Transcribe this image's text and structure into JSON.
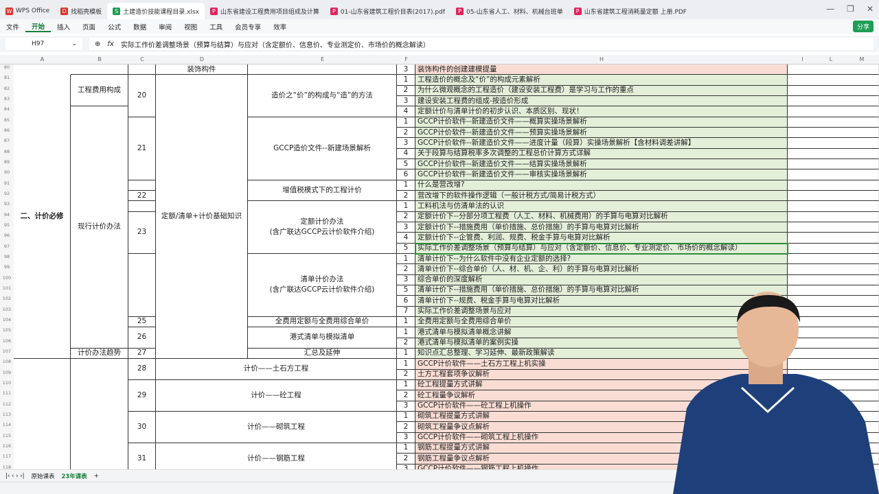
{
  "tabs": [
    {
      "label": "WPS Office",
      "color": "#d9342b",
      "glyph": "W"
    },
    {
      "label": "找稻壳模板",
      "color": "#d9342b",
      "glyph": "D"
    },
    {
      "label": "土建造价技能课程目录.xlsx",
      "color": "#1f9d55",
      "glyph": "S",
      "active": true
    },
    {
      "label": "山东省建设工程费用项目组成及计算",
      "color": "#e0245e",
      "glyph": "P"
    },
    {
      "label": "01-山东省建筑工程价目表(2017).pdf",
      "color": "#e0245e",
      "glyph": "P"
    },
    {
      "label": "05-山东省人工、材料、机械台班单",
      "color": "#e0245e",
      "glyph": "P"
    },
    {
      "label": "山东省建筑工程消耗量定额 上册.PDF",
      "color": "#e0245e",
      "glyph": "P"
    }
  ],
  "menu": [
    "文件",
    "开始",
    "插入",
    "页面",
    "公式",
    "数据",
    "审阅",
    "视图",
    "工具",
    "会员专享",
    "效率"
  ],
  "share_label": "分享",
  "name_box": "H97",
  "formula": "实际工作价差调整场景（预算与结算）与应对（含定额价、信息价、专业测定价、市场价的概念解读）",
  "columns": [
    "A",
    "B",
    "C",
    "D",
    "E",
    "F",
    "H",
    "I",
    "L",
    "M"
  ],
  "colors": {
    "green": "#e3efd9",
    "pink": "#f9ddd4",
    "select": "#2e8b3a"
  },
  "merged": [
    {
      "col": "A",
      "from": 81,
      "to": 107,
      "text": "二、计价必修",
      "bold": true
    },
    {
      "col": "A",
      "from": 108,
      "to": 118,
      "text": ""
    },
    {
      "col": "B",
      "from": 80,
      "to": 80,
      "text": ""
    },
    {
      "col": "B",
      "from": 81,
      "to": 83,
      "text": "工程费用构成"
    },
    {
      "col": "B",
      "from": 84,
      "to": 106,
      "text": "现行计价办法"
    },
    {
      "col": "B",
      "from": 107,
      "to": 107,
      "text": "计价办法趋势"
    },
    {
      "col": "B",
      "from": 108,
      "to": 118,
      "text": ""
    },
    {
      "col": "C",
      "from": 80,
      "to": 80,
      "text": ""
    },
    {
      "col": "C",
      "from": 81,
      "to": 84,
      "text": "20"
    },
    {
      "col": "C",
      "from": 85,
      "to": 90,
      "text": "21"
    },
    {
      "col": "C",
      "from": 91,
      "to": 91,
      "text": ""
    },
    {
      "col": "C",
      "from": 92,
      "to": 92,
      "text": "22"
    },
    {
      "col": "C",
      "from": 93,
      "to": 93,
      "text": ""
    },
    {
      "col": "C",
      "from": 94,
      "to": 97,
      "text": "23"
    },
    {
      "col": "C",
      "from": 98,
      "to": 103,
      "text": ""
    },
    {
      "col": "C",
      "from": 104,
      "to": 104,
      "text": "25"
    },
    {
      "col": "C",
      "from": 105,
      "to": 106,
      "text": "26"
    },
    {
      "col": "C",
      "from": 107,
      "to": 107,
      "text": "27"
    },
    {
      "col": "C",
      "from": 108,
      "to": 109,
      "text": "28"
    },
    {
      "col": "C",
      "from": 110,
      "to": 112,
      "text": "29"
    },
    {
      "col": "C",
      "from": 113,
      "to": 115,
      "text": "30"
    },
    {
      "col": "C",
      "from": 116,
      "to": 118,
      "text": "31"
    },
    {
      "col": "D",
      "from": 80,
      "to": 80,
      "text": "装饰构件"
    },
    {
      "col": "D",
      "from": 81,
      "to": 107,
      "text": "定额/清单+计价基础知识"
    },
    {
      "col": "DE",
      "from": 108,
      "to": 109,
      "text": "计价——土石方工程"
    },
    {
      "col": "DE",
      "from": 110,
      "to": 112,
      "text": "计价——砼工程"
    },
    {
      "col": "DE",
      "from": 113,
      "to": 115,
      "text": "计价——砌筑工程"
    },
    {
      "col": "DE",
      "from": 116,
      "to": 118,
      "text": "计价——钢筋工程"
    },
    {
      "col": "E",
      "from": 80,
      "to": 80,
      "text": ""
    },
    {
      "col": "E",
      "from": 81,
      "to": 84,
      "text": "造价之“价”的构成与“造”的方法"
    },
    {
      "col": "E",
      "from": 85,
      "to": 90,
      "text": "GCCP造价文件--新建场景解析"
    },
    {
      "col": "E",
      "from": 91,
      "to": 92,
      "text": "增值税模式下的工程计价"
    },
    {
      "col": "E",
      "from": 93,
      "to": 97,
      "text": "定额计价办法\n(含广联达GCCP云计价软件介绍)"
    },
    {
      "col": "E",
      "from": 98,
      "to": 103,
      "text": "清单计价办法\n(含广联达GCCP云计价软件介绍)"
    },
    {
      "col": "E",
      "from": 104,
      "to": 104,
      "text": "全费用定额与全费用综合单价"
    },
    {
      "col": "E",
      "from": 105,
      "to": 106,
      "text": "港式清单与模拟清单"
    },
    {
      "col": "E",
      "from": 107,
      "to": 107,
      "text": "汇总及延伸"
    }
  ],
  "rows": [
    {
      "r": 80,
      "f": "3",
      "h": "装饰构件的创建建模提量",
      "c": "pink"
    },
    {
      "r": 81,
      "f": "1",
      "h": "工程造价的概念及“价”的构成元素解析",
      "c": "green"
    },
    {
      "r": 82,
      "f": "2",
      "h": "为什么微观概念的工程造价（建设安装工程费）是学习与工作的重点",
      "c": "green"
    },
    {
      "r": 83,
      "f": "3",
      "h": "建设安装工程费的组成-按造价形成",
      "c": "green"
    },
    {
      "r": 84,
      "f": "4",
      "h": "定额计价与清单计价的初步认识、本质区别、现状！",
      "c": "green"
    },
    {
      "r": 85,
      "f": "1",
      "h": "GCCP计价软件--新建造价文件——概算实操场景解析",
      "c": "green"
    },
    {
      "r": 86,
      "f": "2",
      "h": "GCCP计价软件--新建造价文件——预算实操场景解析",
      "c": "green"
    },
    {
      "r": 87,
      "f": "3",
      "h": "GCCP计价软件--新建造价文件——进度计量（段算）实操场景解析【含材料调差讲解】",
      "c": "green"
    },
    {
      "r": 88,
      "f": "4",
      "h": "关于段算与结算税率多次调整的工程总价计算方式详解",
      "c": "green"
    },
    {
      "r": 89,
      "f": "5",
      "h": "GCCP计价软件--新建造价文件——结算实操场景解析",
      "c": "green"
    },
    {
      "r": 90,
      "f": "6",
      "h": "GCCP计价软件--新建造价文件——审核实操场景解析",
      "c": "green"
    },
    {
      "r": 91,
      "f": "1",
      "h": "什么是营改增?",
      "c": "green"
    },
    {
      "r": 92,
      "f": "2",
      "h": "营改增下的软件操作逻辑（一般计税方式/简易计税方式）",
      "c": "green"
    },
    {
      "r": 93,
      "f": "1",
      "h": "工料机法与仿清单法的认识",
      "c": "green"
    },
    {
      "r": 94,
      "f": "2",
      "h": "定额计价下--分部分项工程费（人工、材料、机械费用）的手算与电算对比解析",
      "c": "green"
    },
    {
      "r": 95,
      "f": "3",
      "h": "定额计价下--措施费用（单价措施、总价措施）的手算与电算对比解析",
      "c": "green"
    },
    {
      "r": 96,
      "f": "4",
      "h": "定额计价下--企管费、利润、规费、税金手算与电算对比解析",
      "c": "green"
    },
    {
      "r": 97,
      "f": "5",
      "h": "实际工作价差调整场景（预算与结算）与应对（含定额价、信息价、专业测定价、市场价的概念解读）",
      "c": "green",
      "selected": true
    },
    {
      "r": 98,
      "f": "1",
      "h": "清单计价下--为什么软件中没有企业定额的选择?",
      "c": "green"
    },
    {
      "r": 99,
      "f": "2",
      "h": "清单计价下--综合单价（人、材、机、企、利）的手算与电算对比解析",
      "c": "green"
    },
    {
      "r": 100,
      "f": "3",
      "h": "综合单价的深度解析",
      "c": "green"
    },
    {
      "r": 101,
      "f": "5",
      "h": "清单计价下--措施费用（单价措施、总价措施）的手算与电算对比解析",
      "c": "green"
    },
    {
      "r": 102,
      "f": "6",
      "h": "清单计价下--规费、税金手算与电算对比解析",
      "c": "green"
    },
    {
      "r": 103,
      "f": "7",
      "h": "实际工作价差调整场景与应对",
      "c": "green"
    },
    {
      "r": 104,
      "f": "1",
      "h": "全费用定额与全费用综合单价",
      "c": "green"
    },
    {
      "r": 105,
      "f": "1",
      "h": "港式清单与模拟清单概念讲解",
      "c": "green"
    },
    {
      "r": 106,
      "f": "2",
      "h": "港式清单与模拟清单的案例实操",
      "c": "green"
    },
    {
      "r": 107,
      "f": "1",
      "h": "知识点汇总整理、学习延伸、最新政策解读",
      "c": "green"
    },
    {
      "r": 108,
      "f": "1",
      "h": "GCCP计价软件——土石方工程上机实操",
      "c": "pink"
    },
    {
      "r": 109,
      "f": "2",
      "h": "土方工程套项争议解析",
      "c": "pink"
    },
    {
      "r": 110,
      "f": "1",
      "h": "砼工程提量方式讲解",
      "c": "pink"
    },
    {
      "r": 111,
      "f": "2",
      "h": "砼工程量争议解析",
      "c": "pink"
    },
    {
      "r": 112,
      "f": "3",
      "h": "GCCP计价软件——砼工程上机操作",
      "c": "pink"
    },
    {
      "r": 113,
      "f": "1",
      "h": "砌筑工程提量方式讲解",
      "c": "pink"
    },
    {
      "r": 114,
      "f": "2",
      "h": "砌筑工程量争议点解析",
      "c": "pink"
    },
    {
      "r": 115,
      "f": "3",
      "h": "GCCP计价软件——砌筑工程上机操作",
      "c": "pink"
    },
    {
      "r": 116,
      "f": "1",
      "h": "钢筋工程提量方式讲解",
      "c": "pink"
    },
    {
      "r": 117,
      "f": "2",
      "h": "钢筋工程量争议点解析",
      "c": "pink"
    },
    {
      "r": 118,
      "f": "3",
      "h": "GCCP计价软件——钢筋工程上机操作",
      "c": "pink"
    }
  ],
  "sheets": [
    "原始课表",
    "23年课表"
  ],
  "active_sheet": "23年课表"
}
